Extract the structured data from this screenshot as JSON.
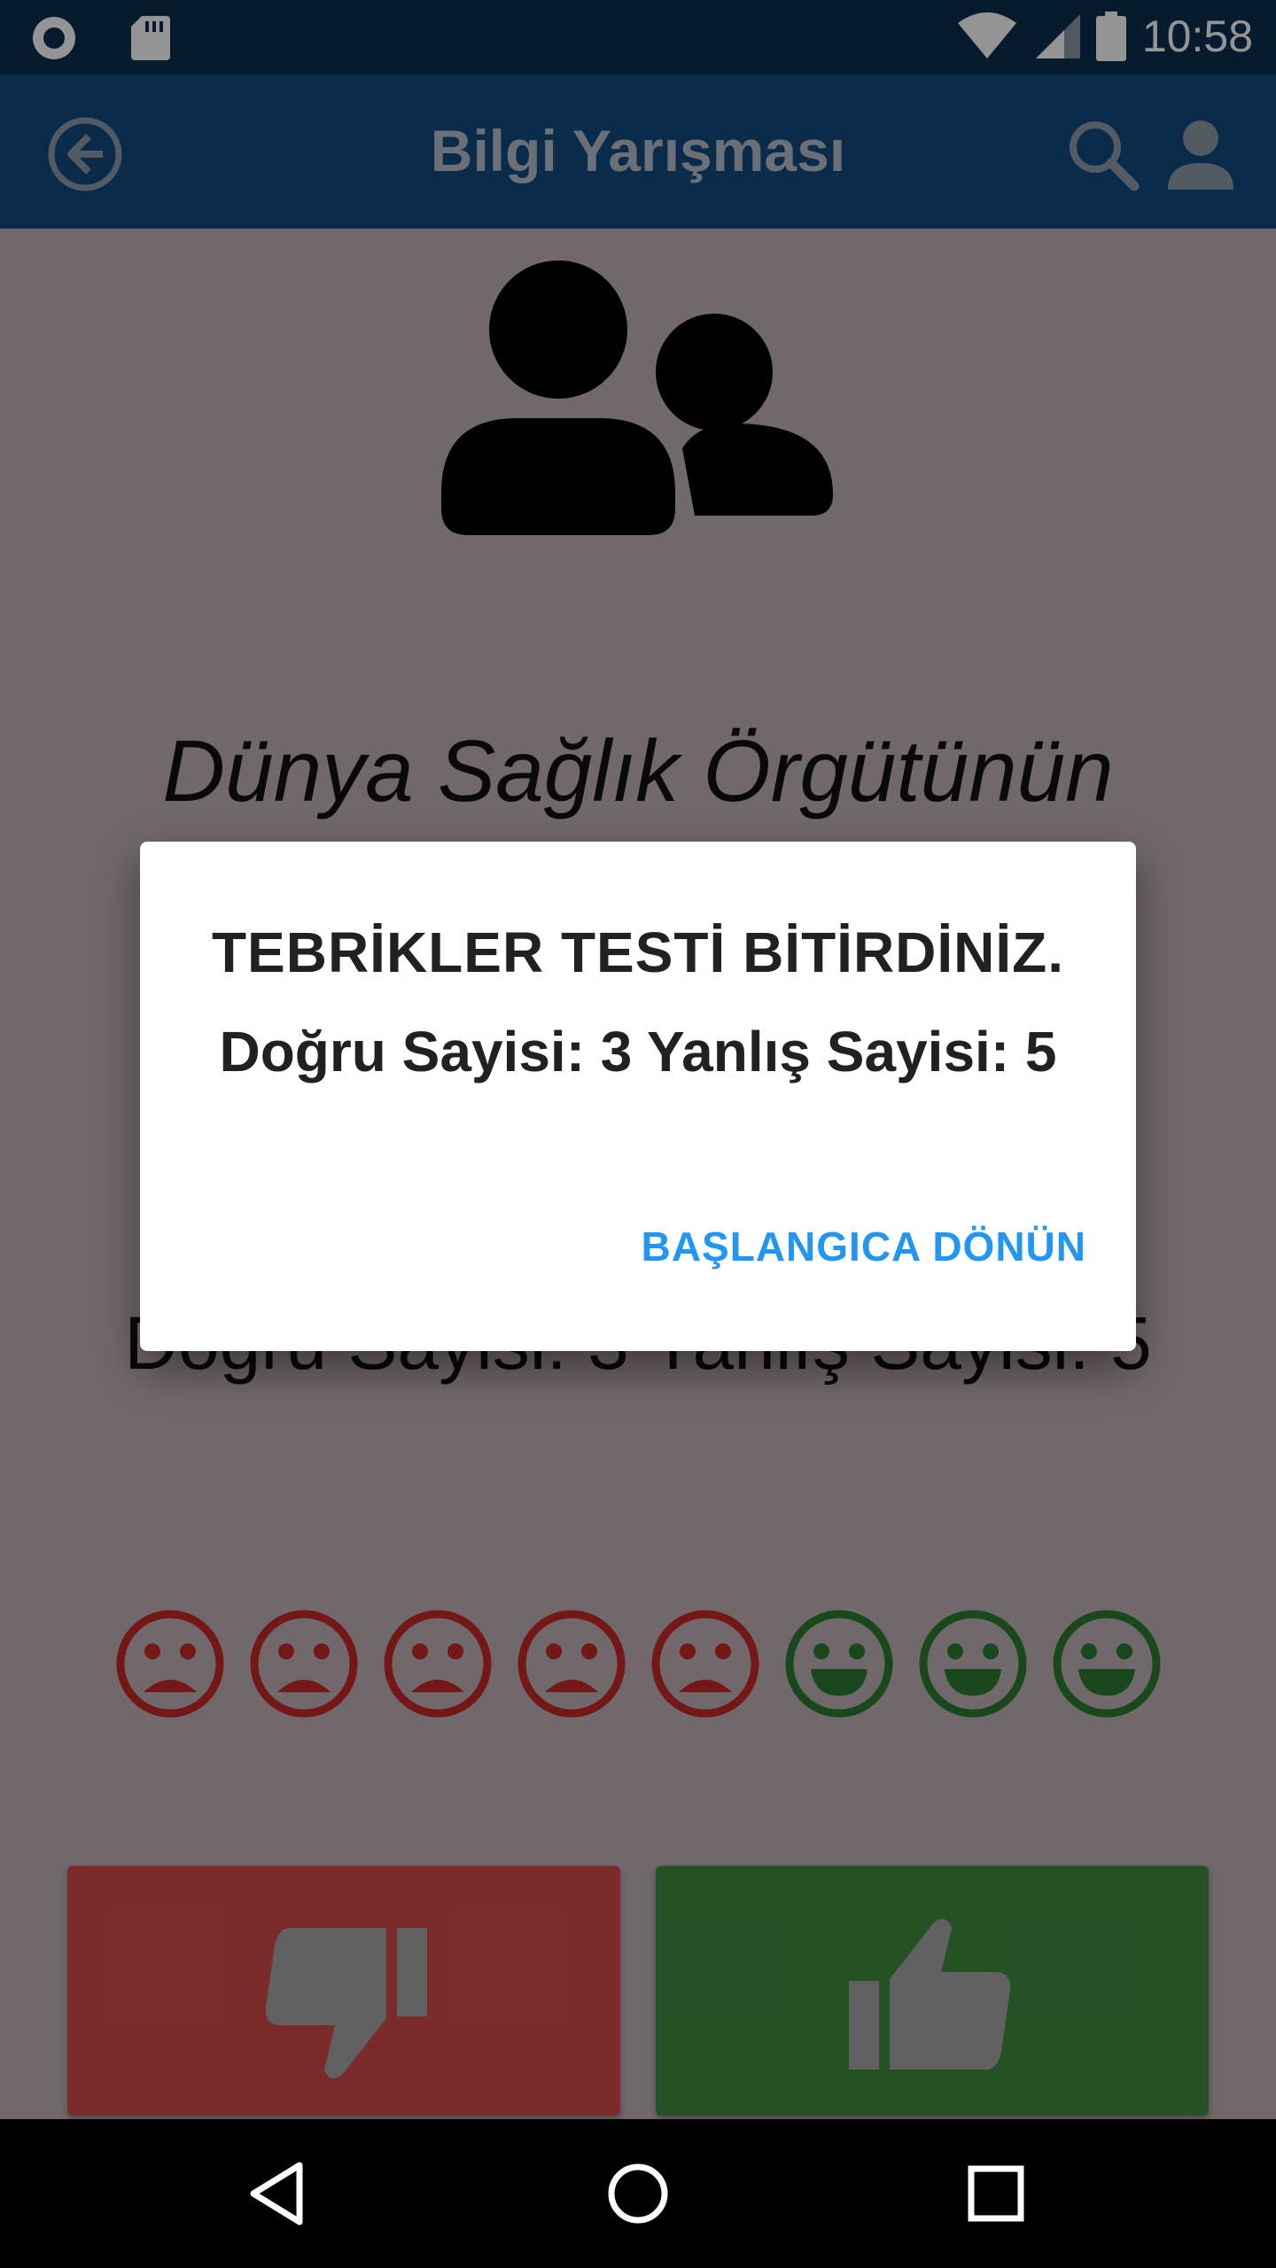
{
  "status_bar": {
    "time": "10:58",
    "icons": [
      "notification-circle-icon",
      "sd-card-icon",
      "wifi-icon",
      "cell-signal-icon",
      "battery-icon"
    ]
  },
  "app_bar": {
    "title": "Bilgi Yarışması",
    "icons": [
      "back-arrow-icon",
      "search-icon",
      "person-icon"
    ]
  },
  "content": {
    "question_text": "Dünya Sağlık Örgütünün",
    "score_text": "Doğru Sayisi: 3 Yanlış Sayisi: 5",
    "faces": [
      "sad",
      "sad",
      "sad",
      "sad",
      "sad",
      "happy",
      "happy",
      "happy"
    ],
    "colors": {
      "sad": "#c62828",
      "happy": "#2e7d32",
      "wrong_button": "#d64b4b",
      "right_button": "#3e8e41"
    }
  },
  "dialog": {
    "title": "TEBRİKLER TESTİ BİTİRDİNİZ.",
    "message": "Doğru Sayisi: 3 Yanlış Sayisi: 5",
    "action_label": "BAŞLANGICA DÖNÜN",
    "accent_color": "#2196f3"
  },
  "nav_bar": {
    "icons": [
      "back-triangle-icon",
      "home-circle-icon",
      "recents-square-icon"
    ]
  }
}
